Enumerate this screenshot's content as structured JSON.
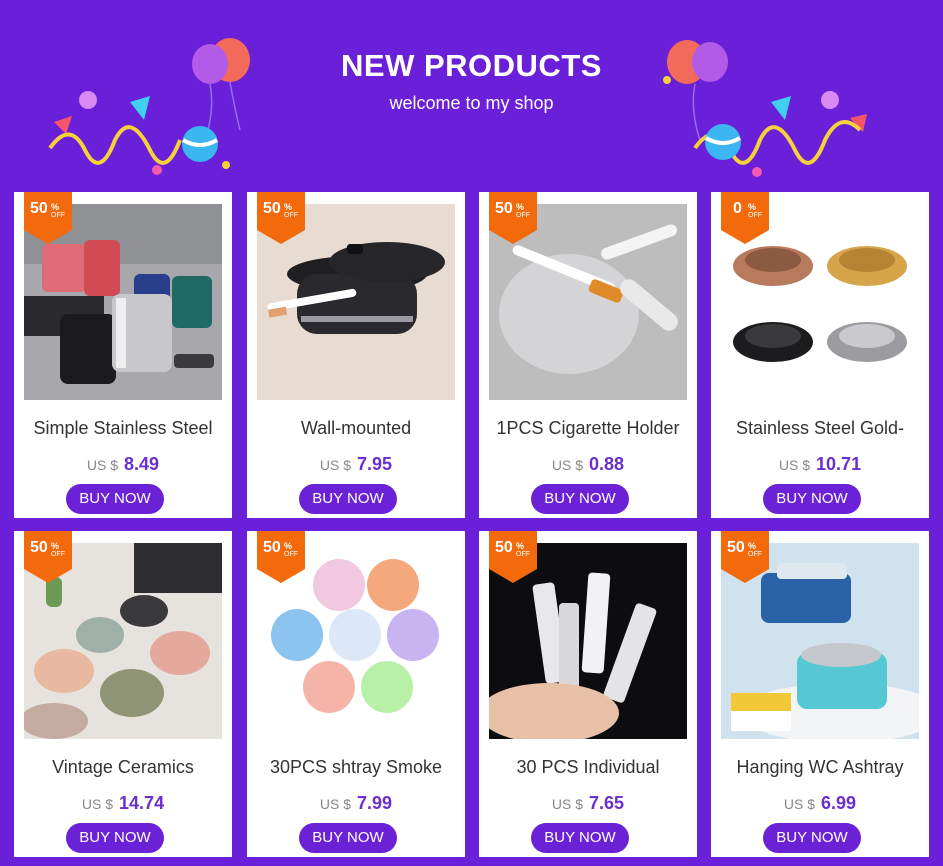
{
  "header": {
    "title": "NEW PRODUCTS",
    "subtitle": "welcome to my shop"
  },
  "colors": {
    "background": "#6a1fd8",
    "button": "#6b22d6",
    "price": "#6b2fcf",
    "badge": "#f26a0c"
  },
  "products": [
    {
      "title": "Simple Stainless Steel",
      "currency": "US $",
      "price": "8.49",
      "discount": "50",
      "pct": "%",
      "off": "OFF",
      "button": "BUY NOW",
      "image_icon": "ashtray-set-photo"
    },
    {
      "title": "Wall-mounted",
      "currency": "US $",
      "price": "7.95",
      "discount": "50",
      "pct": "%",
      "off": "OFF",
      "button": "BUY NOW",
      "image_icon": "wall-ashtray-photo"
    },
    {
      "title": "1PCS Cigarette Holder",
      "currency": "US $",
      "price": "0.88",
      "discount": "50",
      "pct": "%",
      "off": "OFF",
      "button": "BUY NOW",
      "image_icon": "cigarette-holder-photo"
    },
    {
      "title": "Stainless Steel Gold-",
      "currency": "US $",
      "price": "10.71",
      "discount": "0",
      "pct": "%",
      "off": "OFF",
      "button": "BUY NOW",
      "image_icon": "metal-ashtrays-photo"
    },
    {
      "title": "Vintage Ceramics",
      "currency": "US $",
      "price": "14.74",
      "discount": "50",
      "pct": "%",
      "off": "OFF",
      "button": "BUY NOW",
      "image_icon": "ceramic-ashtrays-photo"
    },
    {
      "title": "30PCS shtray Smoke",
      "currency": "US $",
      "price": "7.99",
      "discount": "50",
      "pct": "%",
      "off": "OFF",
      "button": "BUY NOW",
      "image_icon": "crystal-ashtrays-photo"
    },
    {
      "title": "30 PCS Individual",
      "currency": "US $",
      "price": "7.65",
      "discount": "50",
      "pct": "%",
      "off": "OFF",
      "button": "BUY NOW",
      "image_icon": "filter-tips-photo"
    },
    {
      "title": "Hanging WC Ashtray",
      "currency": "US $",
      "price": "6.99",
      "discount": "50",
      "pct": "%",
      "off": "OFF",
      "button": "BUY NOW",
      "image_icon": "hanging-ashtray-photo"
    }
  ]
}
